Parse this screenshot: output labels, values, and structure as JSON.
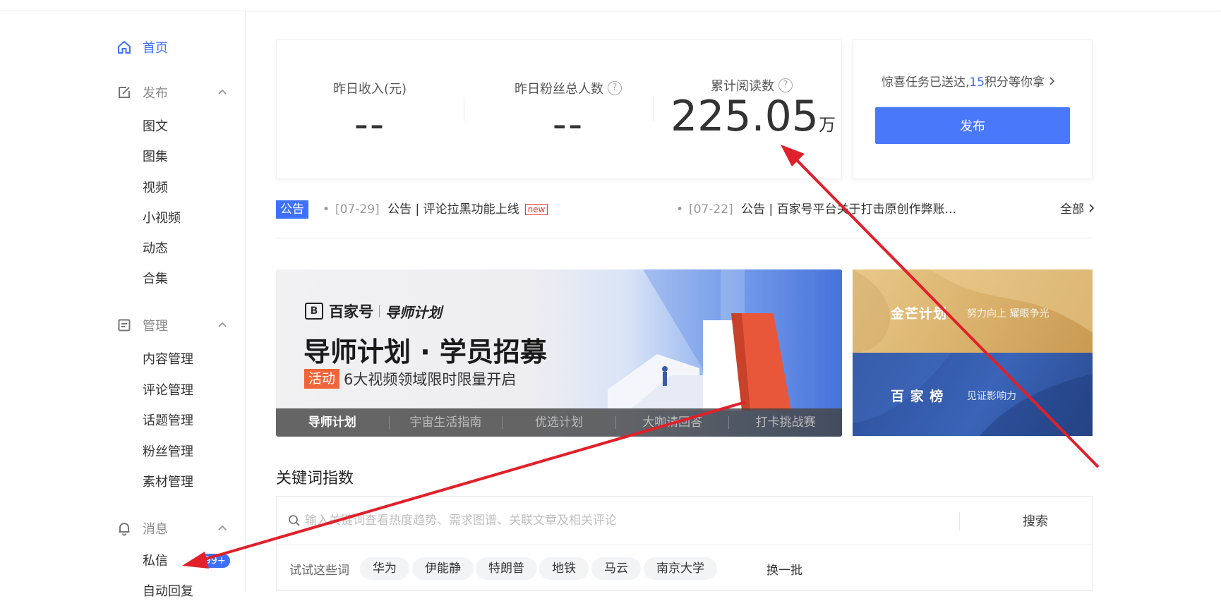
{
  "sidebar": {
    "home": "首页",
    "publish": {
      "label": "发布",
      "items": [
        "图文",
        "图集",
        "视频",
        "小视频",
        "动态",
        "合集"
      ]
    },
    "manage": {
      "label": "管理",
      "items": [
        "内容管理",
        "评论管理",
        "话题管理",
        "粉丝管理",
        "素材管理"
      ]
    },
    "message": {
      "label": "消息",
      "items": [
        "私信",
        "自动回复"
      ],
      "dm_badge": "99+"
    }
  },
  "stats": {
    "income_label": "昨日收入(元)",
    "income_value": "--",
    "fans_label": "昨日粉丝总人数",
    "fans_value": "--",
    "reads_label": "累计阅读数",
    "reads_value": "225.05",
    "reads_unit": "万"
  },
  "task": {
    "text_before": "惊喜任务已送达,",
    "points": "15",
    "text_after": "积分等你拿",
    "publish_button": "发布"
  },
  "notices": {
    "tag": "公告",
    "items": [
      {
        "date": "[07-29]",
        "title": "公告 | 评论拉黑功能上线",
        "badge": "new"
      },
      {
        "date": "[07-22]",
        "title": "公告 | 百家号平台关于打击原创作弊账..."
      }
    ],
    "all": "全部"
  },
  "banner": {
    "logo_text": "百家号",
    "logo_sub": "导师计划",
    "headline": "导师计划 · 学员招募",
    "activity_tag": "活动",
    "subline": "6大视频领域限时限量开启",
    "tabs": [
      "导师计划",
      "宇宙生活指南",
      "优选计划",
      "大咖请回答",
      "打卡挑战赛"
    ]
  },
  "side_banners": [
    {
      "title": "金芒计划",
      "subtitle": "努力向上 耀眼争光"
    },
    {
      "title": "百 家 榜",
      "subtitle": "见证影响力"
    }
  ],
  "keyword": {
    "title": "关键词指数",
    "placeholder": "输入关键词查看热度趋势、需求图谱、关联文章及相关评论",
    "search_button": "搜索",
    "try_label": "试试这些词",
    "chips": [
      "华为",
      "伊能静",
      "特朗普",
      "地铁",
      "马云",
      "南京大学"
    ],
    "refresh": "换一批"
  },
  "colors": {
    "accent": "#3d70ff",
    "annotation_arrow": "#e0202a"
  }
}
